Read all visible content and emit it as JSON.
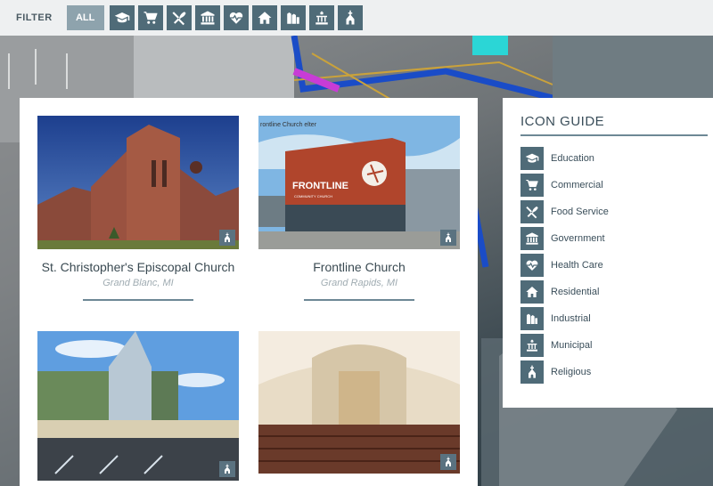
{
  "filter": {
    "label": "FILTER",
    "all_label": "ALL",
    "buttons": [
      {
        "icon": "education-icon",
        "name": "Education"
      },
      {
        "icon": "commercial-icon",
        "name": "Commercial"
      },
      {
        "icon": "food-service-icon",
        "name": "Food Service"
      },
      {
        "icon": "government-icon",
        "name": "Government"
      },
      {
        "icon": "health-care-icon",
        "name": "Health Care"
      },
      {
        "icon": "residential-icon",
        "name": "Residential"
      },
      {
        "icon": "industrial-icon",
        "name": "Industrial"
      },
      {
        "icon": "municipal-icon",
        "name": "Municipal"
      },
      {
        "icon": "religious-icon",
        "name": "Religious"
      }
    ]
  },
  "projects": [
    {
      "title": "St. Christopher's Episcopal Church",
      "location": "Grand Blanc, MI",
      "category": "religious-icon"
    },
    {
      "title": "Frontline Church",
      "location": "Grand Rapids, MI",
      "category": "religious-icon",
      "photo_caption": "rontline Church elter",
      "sign_text": "FRONTLINE",
      "sign_subtext": "COMMUNITY CHURCH"
    },
    {
      "title": "",
      "location": "",
      "category": "religious-icon"
    },
    {
      "title": "",
      "location": "",
      "category": "religious-icon"
    }
  ],
  "guide": {
    "title": "ICON GUIDE",
    "items": [
      {
        "label": "Education",
        "icon": "education-icon"
      },
      {
        "label": "Commercial",
        "icon": "commercial-icon"
      },
      {
        "label": "Food Service",
        "icon": "food-service-icon"
      },
      {
        "label": "Government",
        "icon": "government-icon"
      },
      {
        "label": "Health Care",
        "icon": "health-care-icon"
      },
      {
        "label": "Residential",
        "icon": "residential-icon"
      },
      {
        "label": "Industrial",
        "icon": "industrial-icon"
      },
      {
        "label": "Municipal",
        "icon": "municipal-icon"
      },
      {
        "label": "Religious",
        "icon": "religious-icon"
      }
    ]
  },
  "colors": {
    "accent": "#4f6b78",
    "all_button": "#8ea3ad",
    "rule": "#6d8895"
  }
}
